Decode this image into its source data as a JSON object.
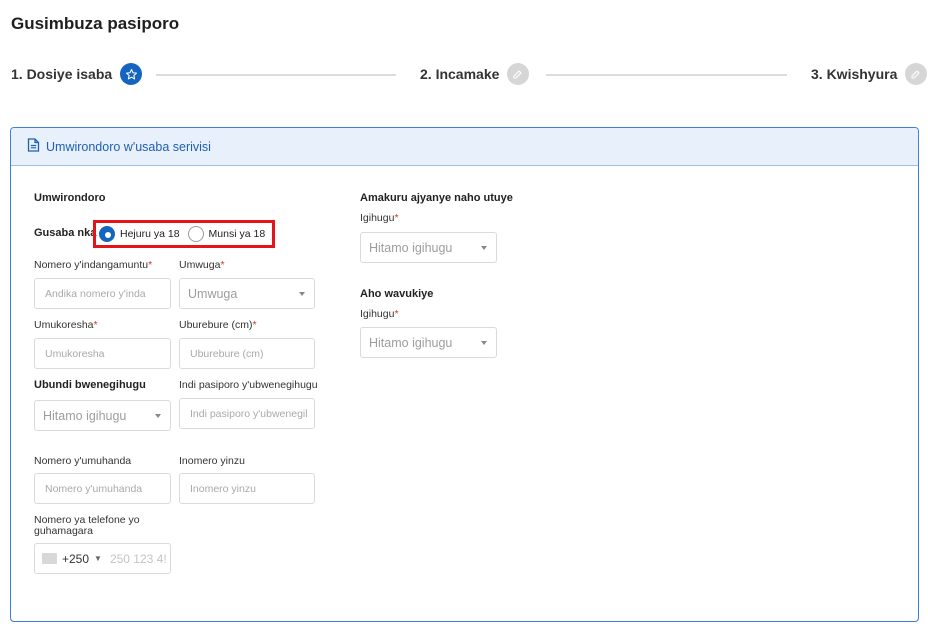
{
  "title": "Gusimbuza pasiporo",
  "steps": [
    {
      "label": "1. Dosiye isaba",
      "icon": "star-icon",
      "state": "active"
    },
    {
      "label": "2. Incamake",
      "icon": "edit-icon",
      "state": "inactive"
    },
    {
      "label": "3. Kwishyura",
      "icon": "edit-icon",
      "state": "inactive"
    }
  ],
  "panel": {
    "header_title": "Umwirondoro w'usaba serivisi",
    "header_icon": "document-icon"
  },
  "form": {
    "section_identity": "Umwirondoro",
    "age_label": "Gusaba nka",
    "age_options": [
      "Hejuru ya 18",
      "Munsi ya 18"
    ],
    "age_selected": "Hejuru ya 18",
    "id_number": {
      "label": "Nomero y'indangamuntu",
      "placeholder": "Andika nomero y'inda"
    },
    "gender": {
      "label": "Umwuga",
      "value": "Umwuga"
    },
    "employer": {
      "label": "Umukoresha",
      "placeholder": "Umukoresha"
    },
    "height": {
      "label": "Uburebure (cm)",
      "placeholder": "Uburebure (cm)"
    },
    "nationality_group": {
      "label": "Ubundi bwenegihugu",
      "value": "Hitamo igihugu"
    },
    "other_passport": {
      "label": "Indi pasiporo y'ubwenegihugu",
      "placeholder": "Indi pasiporo y'ubwenegil"
    },
    "road_number": {
      "label": "Nomero y'umuhanda",
      "placeholder": "Nomero y'umuhanda"
    },
    "house_number": {
      "label": "Inomero yinzu",
      "placeholder": "Inomero yinzu"
    },
    "phone": {
      "label": "Nomero ya telefone yo guhamagara",
      "code": "+250",
      "placeholder": "250 123 4!"
    },
    "section_residence": "Amakuru ajyanye naho utuye",
    "residence_country": {
      "label": "Igihugu",
      "value": "Hitamo igihugu"
    },
    "section_birthplace": "Aho wavukiye",
    "birth_country": {
      "label": "Igihugu",
      "value": "Hitamo igihugu"
    }
  },
  "colors": {
    "accent": "#1565c0",
    "highlight": "#e5141b",
    "panel_header": "#e8f1fb",
    "required": "#d32f2f"
  }
}
